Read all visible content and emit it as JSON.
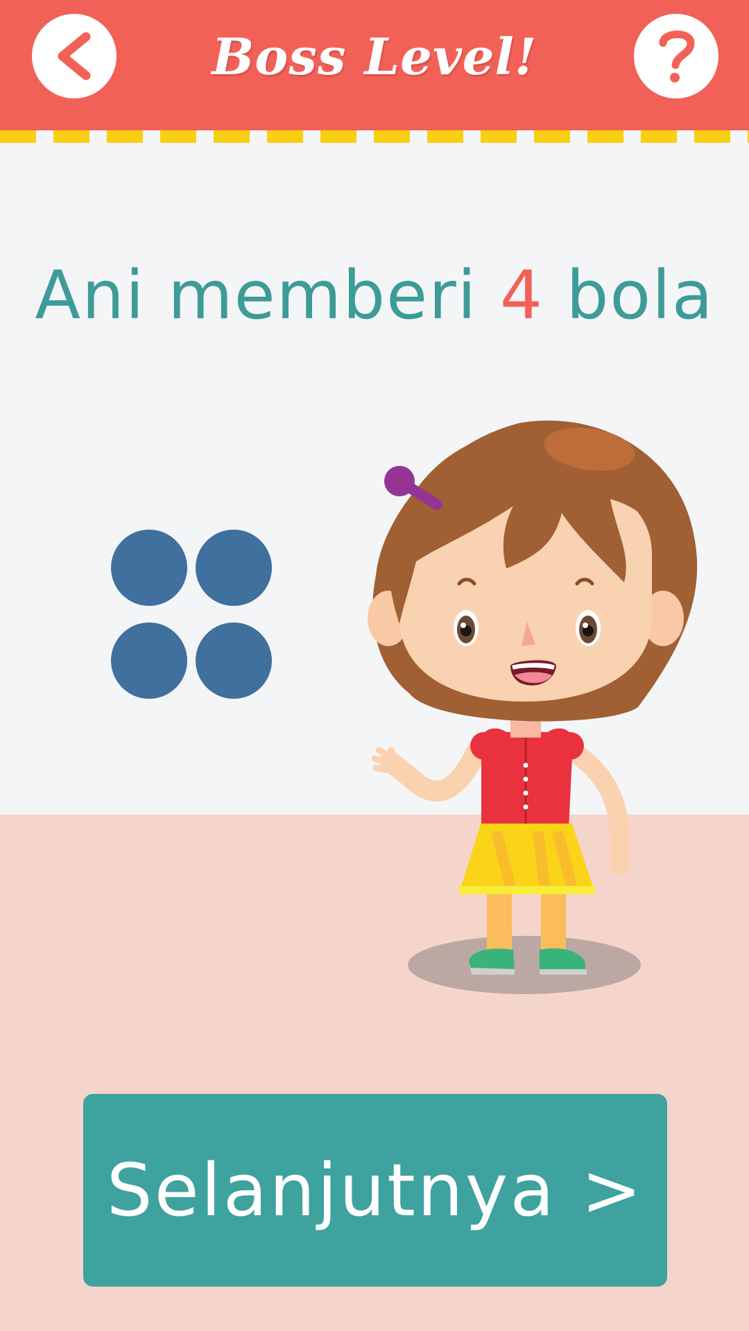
{
  "header": {
    "title": "Boss Level!",
    "back_icon": "chevron-left-icon",
    "help_icon": "question-mark-icon",
    "background": "#f26157",
    "stripe_color": "#f9cf12"
  },
  "question": {
    "prefix": "Ani memberi ",
    "number": "4",
    "suffix": " bola",
    "text_color": "#3d9b98",
    "number_color": "#f26157"
  },
  "balls": {
    "count": 4,
    "color": "#3f709e"
  },
  "character": {
    "name": "Ani",
    "icon": "girl-character-illustration"
  },
  "next_button": {
    "label": "Selanjutnya >",
    "color": "#3ea29f"
  }
}
